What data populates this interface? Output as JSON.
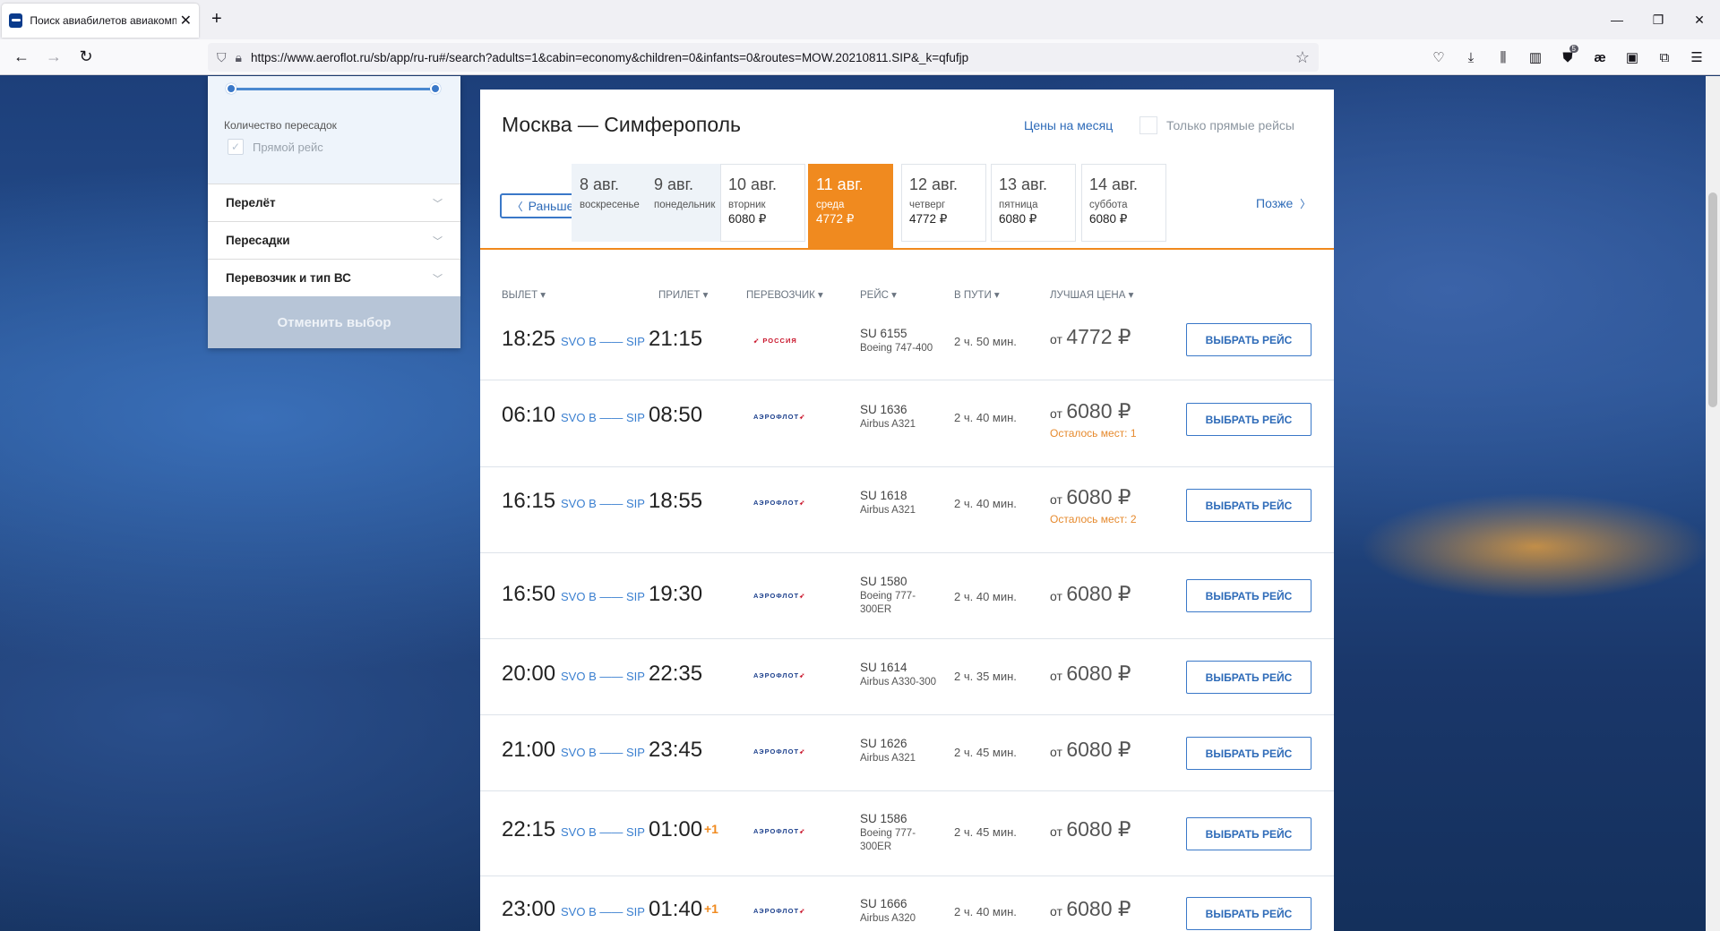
{
  "browser": {
    "tab_title": "Поиск авиабилетов авиакомпании",
    "url": "https://www.aeroflot.ru/sb/app/ru-ru#/search?adults=1&cabin=economy&children=0&infants=0&routes=MOW.20210811.SIP&_k=qfufjp",
    "ublock_badge": "5"
  },
  "filters": {
    "transfers_label": "Количество пересадок",
    "direct_label": "Прямой рейс",
    "rows": [
      "Перелёт",
      "Пересадки",
      "Перевозчик и тип ВС"
    ],
    "reset_label": "Отменить выбор"
  },
  "header": {
    "title": "Москва — Симферополь",
    "month_prices": "Цены на месяц",
    "direct_only": "Только прямые рейсы"
  },
  "dates": {
    "earlier": "Раньше",
    "later": "Позже",
    "cards": [
      {
        "day": "8 авг.",
        "weekday": "воскресенье",
        "price": ""
      },
      {
        "day": "9 авг.",
        "weekday": "понедельник",
        "price": ""
      },
      {
        "day": "10 авг.",
        "weekday": "вторник",
        "price": "6080 ₽"
      },
      {
        "day": "11 авг.",
        "weekday": "среда",
        "price": "4772 ₽"
      },
      {
        "day": "12 авг.",
        "weekday": "четверг",
        "price": "4772 ₽"
      },
      {
        "day": "13 авг.",
        "weekday": "пятница",
        "price": "6080 ₽"
      },
      {
        "day": "14 авг.",
        "weekday": "суббота",
        "price": "6080 ₽"
      }
    ]
  },
  "columns": {
    "dep": "ВЫЛЕТ",
    "arr": "ПРИЛЕТ",
    "carrier": "ПЕРЕВОЗЧИК",
    "flight": "РЕЙС",
    "duration": "В ПУТИ",
    "price": "ЛУЧШАЯ ЦЕНА"
  },
  "flights": [
    {
      "dep": "18:25",
      "route": "SVO B —— SIP",
      "arr": "21:15",
      "plus": "",
      "carrier": "РОССИЯ",
      "num": "SU 6155",
      "aircraft": "Boeing 747-400",
      "duration": "2 ч. 50 мин.",
      "from": "от",
      "price": "4772 ₽",
      "seats": "",
      "button": "ВЫБРАТЬ РЕЙС"
    },
    {
      "dep": "06:10",
      "route": "SVO B —— SIP",
      "arr": "08:50",
      "plus": "",
      "carrier": "АЭРОФЛОТ",
      "num": "SU 1636",
      "aircraft": "Airbus A321",
      "duration": "2 ч. 40 мин.",
      "from": "от",
      "price": "6080 ₽",
      "seats": "Осталось мест: 1",
      "button": "ВЫБРАТЬ РЕЙС"
    },
    {
      "dep": "16:15",
      "route": "SVO B —— SIP",
      "arr": "18:55",
      "plus": "",
      "carrier": "АЭРОФЛОТ",
      "num": "SU 1618",
      "aircraft": "Airbus A321",
      "duration": "2 ч. 40 мин.",
      "from": "от",
      "price": "6080 ₽",
      "seats": "Осталось мест: 2",
      "button": "ВЫБРАТЬ РЕЙС"
    },
    {
      "dep": "16:50",
      "route": "SVO B —— SIP",
      "arr": "19:30",
      "plus": "",
      "carrier": "АЭРОФЛОТ",
      "num": "SU 1580",
      "aircraft": "Boeing 777-300ER",
      "duration": "2 ч. 40 мин.",
      "from": "от",
      "price": "6080 ₽",
      "seats": "",
      "button": "ВЫБРАТЬ РЕЙС"
    },
    {
      "dep": "20:00",
      "route": "SVO B —— SIP",
      "arr": "22:35",
      "plus": "",
      "carrier": "АЭРОФЛОТ",
      "num": "SU 1614",
      "aircraft": "Airbus A330-300",
      "duration": "2 ч. 35 мин.",
      "from": "от",
      "price": "6080 ₽",
      "seats": "",
      "button": "ВЫБРАТЬ РЕЙС"
    },
    {
      "dep": "21:00",
      "route": "SVO B —— SIP",
      "arr": "23:45",
      "plus": "",
      "carrier": "АЭРОФЛОТ",
      "num": "SU 1626",
      "aircraft": "Airbus A321",
      "duration": "2 ч. 45 мин.",
      "from": "от",
      "price": "6080 ₽",
      "seats": "",
      "button": "ВЫБРАТЬ РЕЙС"
    },
    {
      "dep": "22:15",
      "route": "SVO B —— SIP",
      "arr": "01:00",
      "plus": "+1",
      "carrier": "АЭРОФЛОТ",
      "num": "SU 1586",
      "aircraft": "Boeing 777-300ER",
      "duration": "2 ч. 45 мин.",
      "from": "от",
      "price": "6080 ₽",
      "seats": "",
      "button": "ВЫБРАТЬ РЕЙС"
    },
    {
      "dep": "23:00",
      "route": "SVO B —— SIP",
      "arr": "01:40",
      "plus": "+1",
      "carrier": "АЭРОФЛОТ",
      "num": "SU 1666",
      "aircraft": "Airbus A320",
      "duration": "2 ч. 40 мин.",
      "from": "от",
      "price": "6080 ₽",
      "seats": "",
      "button": "ВЫБРАТЬ РЕЙС"
    }
  ]
}
